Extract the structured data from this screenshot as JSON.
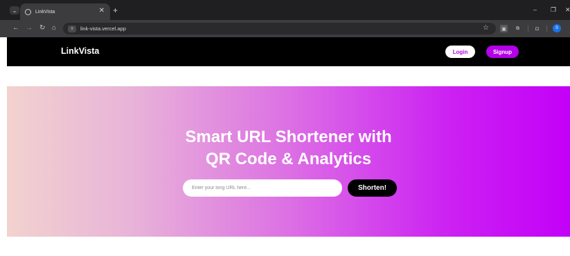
{
  "browser": {
    "tab_title": "LinkVista",
    "tab_close": "✕",
    "new_tab": "+",
    "url": "link-vista.vercel.app",
    "window_controls": {
      "minimize": "–",
      "restore": "❐",
      "close": "✕"
    },
    "profile_initial": "S"
  },
  "site": {
    "brand": "LinkVista",
    "nav": {
      "login_label": "Login",
      "signup_label": "Signup"
    },
    "hero": {
      "title_line1": "Smart URL Shortener with",
      "title_line2": "QR Code & Analytics",
      "input_placeholder": "Enter your long URL here...",
      "shorten_label": "Shorten!"
    }
  },
  "colors": {
    "accent": "#b400e8",
    "nav_bg": "#000000",
    "gradient_start": "#f2d2cf",
    "gradient_end": "#c300f8"
  }
}
